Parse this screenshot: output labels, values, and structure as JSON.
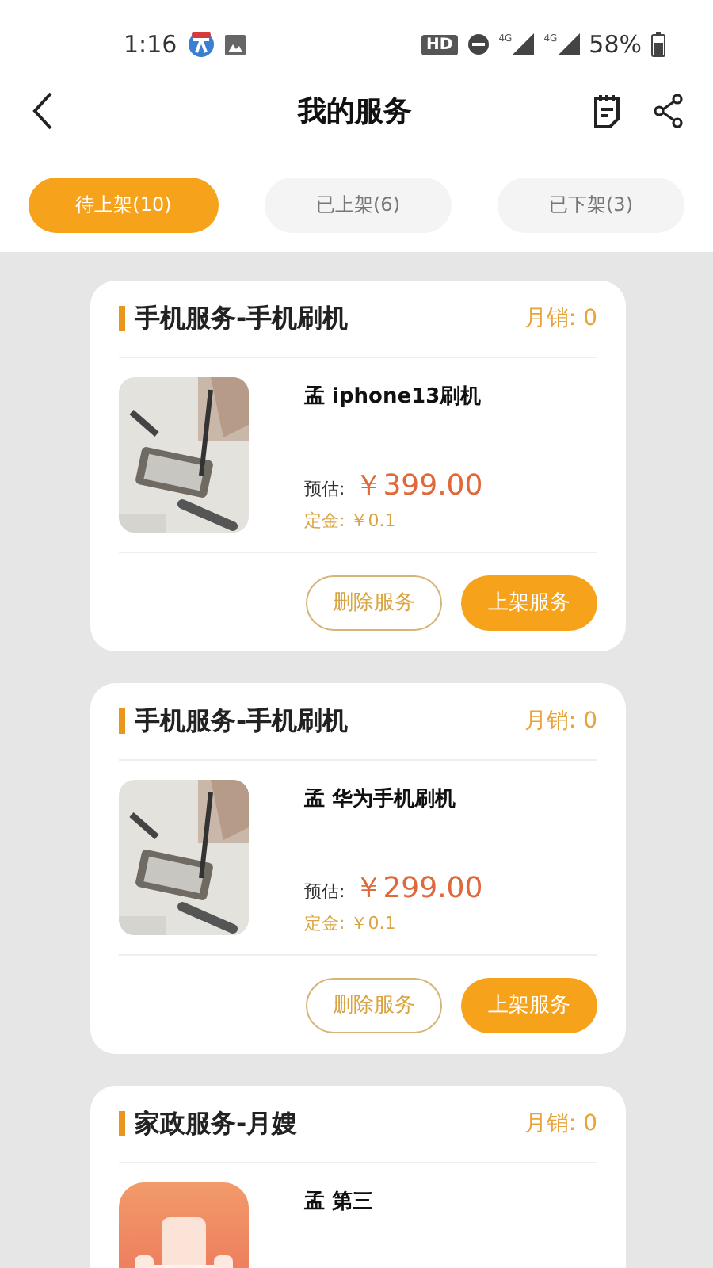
{
  "status_bar": {
    "time": "1:16",
    "hd": "HD",
    "signals": [
      "4G",
      "4G"
    ],
    "battery": "58%"
  },
  "header": {
    "title": "我的服务"
  },
  "tabs": [
    {
      "label": "待上架(10)",
      "selected": true
    },
    {
      "label": "已上架(6)",
      "selected": false
    },
    {
      "label": "已下架(3)",
      "selected": false
    }
  ],
  "services": [
    {
      "category": "手机服务-手机刷机",
      "sales": "月销: 0",
      "name": "孟 iphone13刷机",
      "estimate_label": "预估:",
      "price": "￥399.00",
      "deposit": "定金: ￥0.1",
      "buttons": [
        "删除服务",
        "上架服务"
      ]
    },
    {
      "category": "手机服务-手机刷机",
      "sales": "月销: 0",
      "name": "孟 华为手机刷机",
      "estimate_label": "预估:",
      "price": "￥299.00",
      "deposit": "定金: ￥0.1",
      "buttons": [
        "删除服务",
        "上架服务"
      ]
    },
    {
      "category": "家政服务-月嫂",
      "sales": "月销: 0",
      "kind": "illustration",
      "name": "孟 第三"
    }
  ]
}
